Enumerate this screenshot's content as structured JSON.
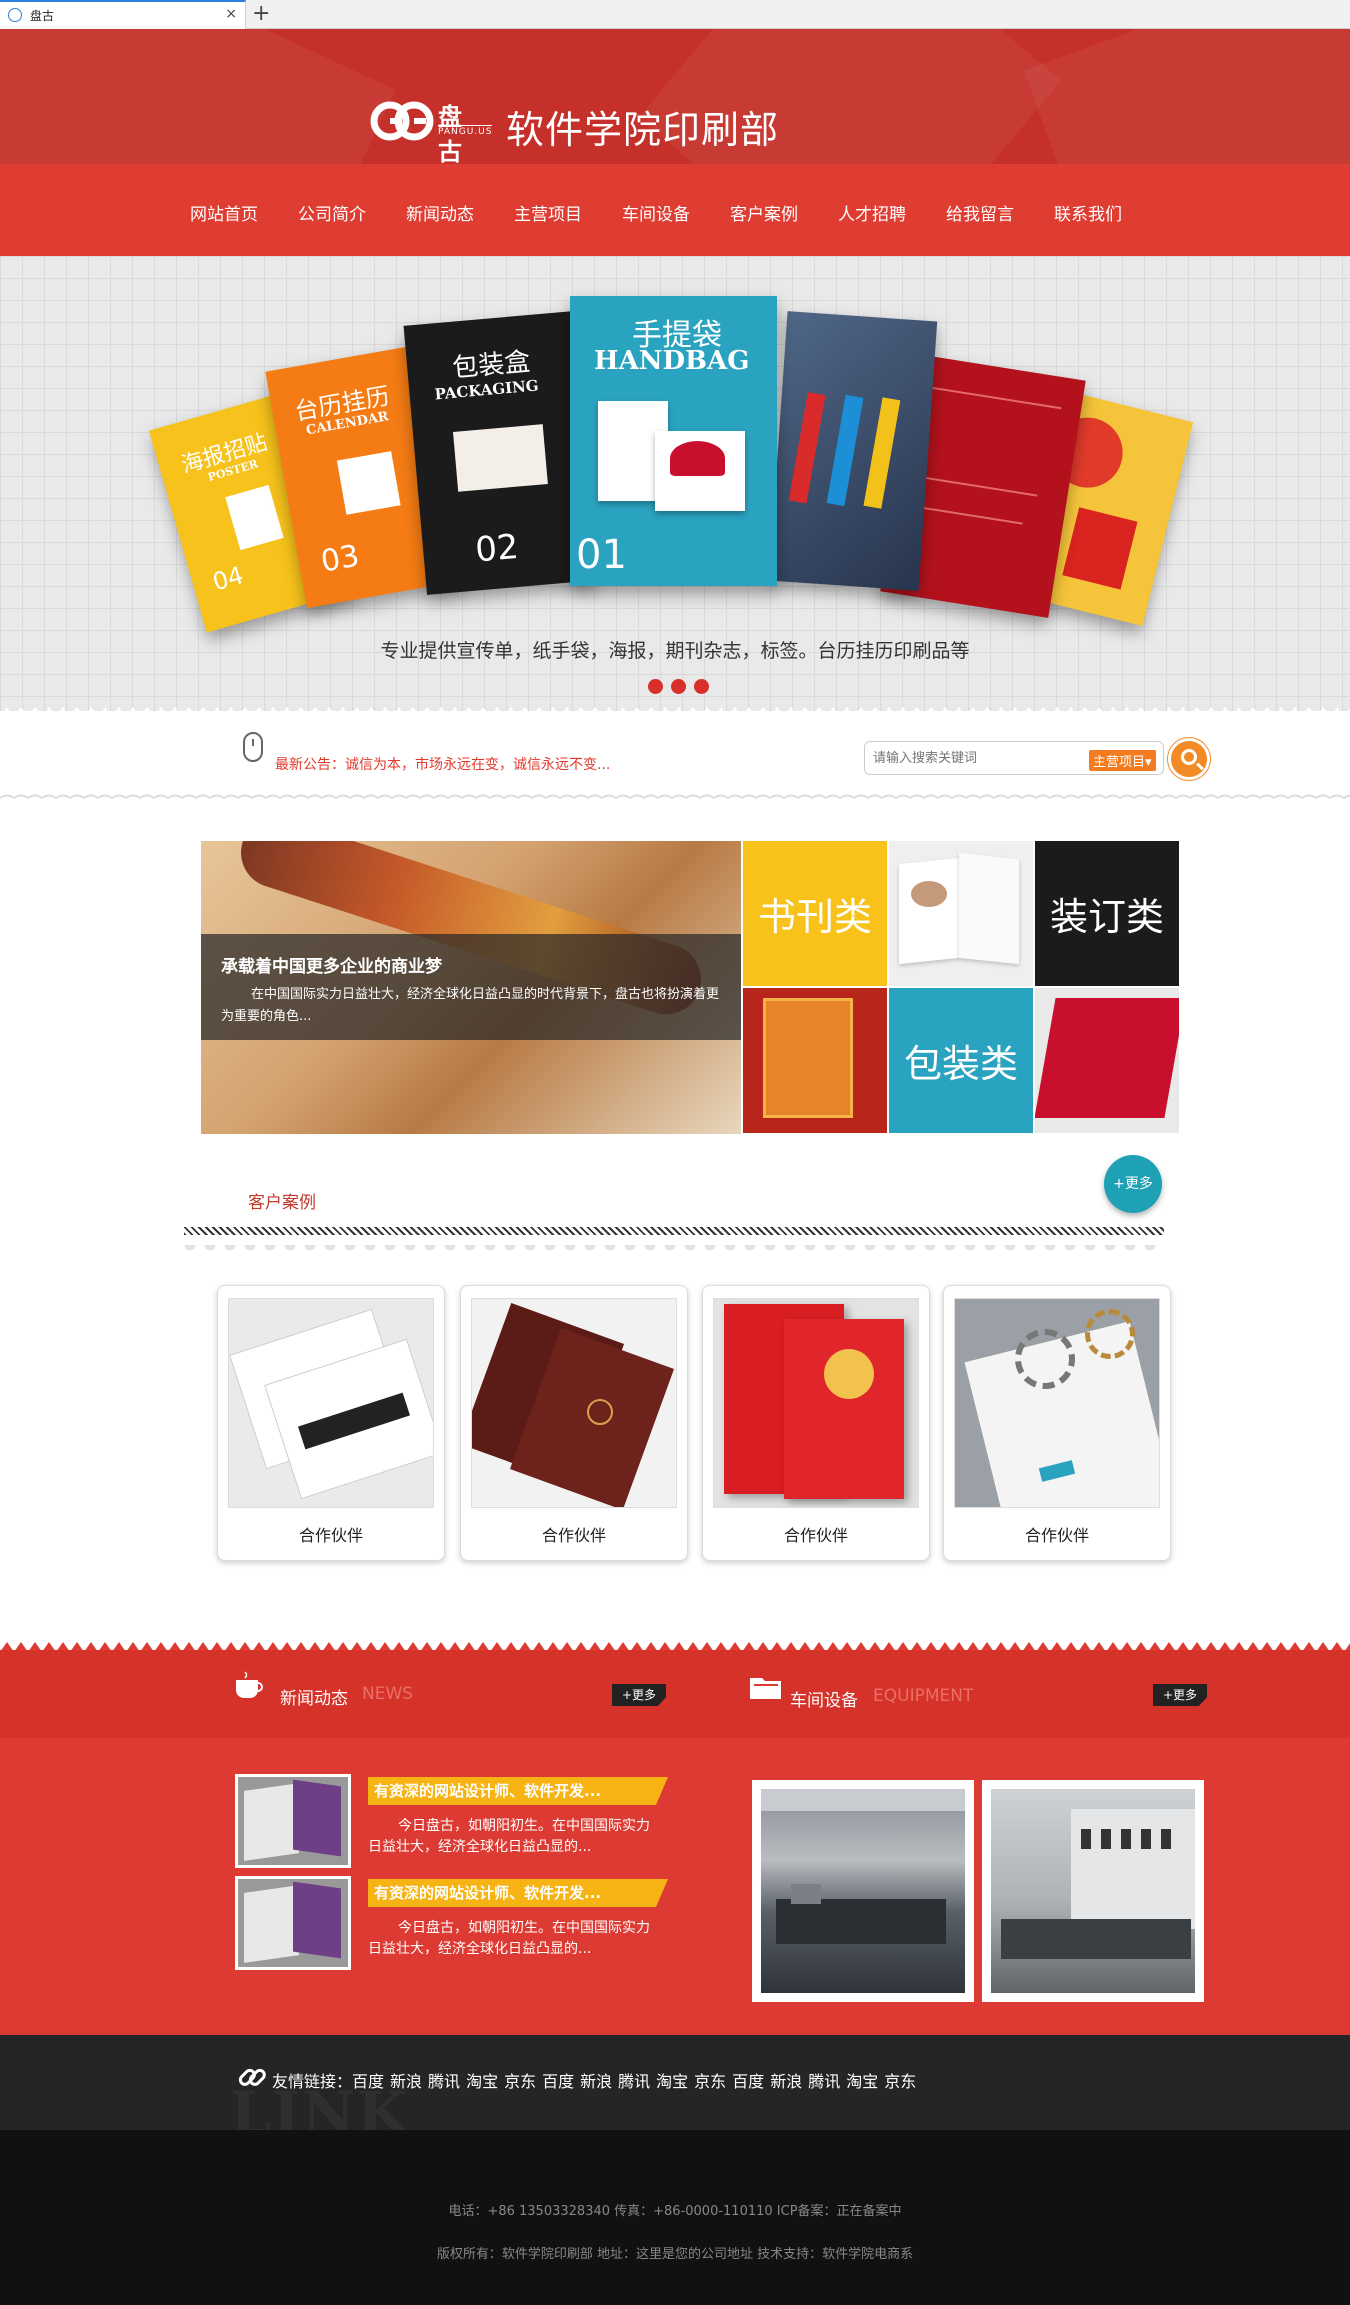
{
  "browser": {
    "tab_title": "盘古",
    "close_glyph": "×",
    "new_tab_glyph": "+"
  },
  "header": {
    "logo_mark": "GG",
    "brand": "盘古",
    "brand_sub": "PANGU.US",
    "site_name": "软件学院印刷部",
    "brand_color": "#c6302a"
  },
  "nav": {
    "items": [
      "网站首页",
      "公司简介",
      "新闻动态",
      "主营项目",
      "车间设备",
      "客户案例",
      "人才招聘",
      "给我留言",
      "联系我们"
    ]
  },
  "banner": {
    "cards": [
      {
        "cn": "海报招贴",
        "en": "POSTER",
        "num": "04",
        "color": "#f6c21b"
      },
      {
        "cn": "台历挂历",
        "en": "CALENDAR",
        "num": "03",
        "color": "#f57c14"
      },
      {
        "cn": "包装盒",
        "en": "PACKAGING",
        "num": "02",
        "color": "#1b1b1b"
      },
      {
        "cn": "手提袋",
        "en": "HANDBAG",
        "num": "01",
        "color": "#2aa3c0"
      }
    ],
    "caption": "专业提供宣传单，纸手袋，海报，期刊杂志，标签。台历挂历印刷品等",
    "slides": 3
  },
  "notice": {
    "text": "最新公告：诚信为本，市场永远在变，诚信永远不变..."
  },
  "search": {
    "placeholder": "请输入搜索关键词",
    "category": "主营项目▾"
  },
  "feature": {
    "title": "承载着中国更多企业的商业梦",
    "desc": "在中国国际实力日益壮大，经济全球化日益凸显的时代背景下，盘古也将扮演着更为重要的角色..."
  },
  "categories": [
    "书刊类",
    "装订类",
    "包装类"
  ],
  "cases": {
    "title": "客户案例",
    "more": "+更多",
    "items": [
      {
        "caption": "合作伙伴"
      },
      {
        "caption": "合作伙伴"
      },
      {
        "caption": "合作伙伴"
      },
      {
        "caption": "合作伙伴"
      }
    ]
  },
  "news": {
    "title": "新闻动态",
    "title_en": "NEWS",
    "more": "+更多",
    "items": [
      {
        "headline": "有资深的网站设计师、软件开发...",
        "body": "今日盘古，如朝阳初生。在中国国际实力日益壮大，经济全球化日益凸显的..."
      },
      {
        "headline": "有资深的网站设计师、软件开发...",
        "body": "今日盘古，如朝阳初生。在中国国际实力日益壮大，经济全球化日益凸显的..."
      }
    ]
  },
  "equipment": {
    "title": "车间设备",
    "title_en": "EQUIPMENT",
    "more": "+更多"
  },
  "links": {
    "label": "友情链接：",
    "bg_word": "LINK",
    "items": [
      "百度",
      "新浪",
      "腾讯",
      "淘宝",
      "京东",
      "百度",
      "新浪",
      "腾讯",
      "淘宝",
      "京东",
      "百度",
      "新浪",
      "腾讯",
      "淘宝",
      "京东"
    ]
  },
  "footer": {
    "line1": "电话：+86 13503328340 传真：+86-0000-110110 ICP备案：正在备案中",
    "line2": "版权所有：软件学院印刷部 地址：这里是您的公司地址 技术支持：软件学院电商系"
  }
}
